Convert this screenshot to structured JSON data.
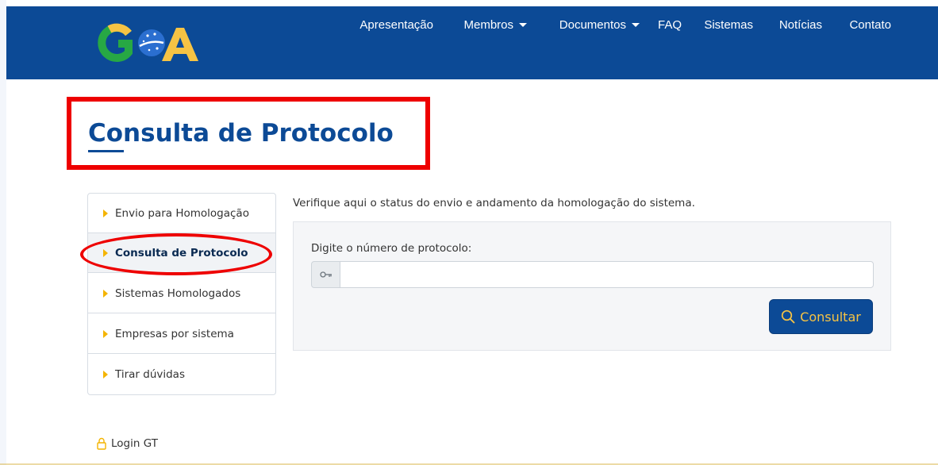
{
  "brand": {
    "logo_text": "GOA",
    "colors": {
      "navy": "#0c4a96",
      "yellow": "#f6c344",
      "green": "#27a844"
    }
  },
  "nav": {
    "items": [
      {
        "label": "Apresentação",
        "dropdown": false
      },
      {
        "label": "Membros",
        "dropdown": true
      },
      {
        "label": "Documentos",
        "dropdown": true
      },
      {
        "label": "FAQ",
        "dropdown": false
      },
      {
        "label": "Sistemas",
        "dropdown": false
      },
      {
        "label": "Notícias",
        "dropdown": false
      },
      {
        "label": "Contato",
        "dropdown": false
      }
    ]
  },
  "page": {
    "title": "Consulta de Protocolo"
  },
  "sidebar": {
    "active_index": 1,
    "items": [
      {
        "label": "Envio para Homologação"
      },
      {
        "label": "Consulta de Protocolo"
      },
      {
        "label": "Sistemas Homologados"
      },
      {
        "label": "Empresas por sistema"
      },
      {
        "label": "Tirar dúvidas"
      }
    ]
  },
  "main": {
    "intro": "Verifique aqui o status do envio e andamento da homologação do sistema.",
    "form": {
      "label": "Digite o número de protocolo:",
      "value": "",
      "placeholder": "",
      "addon_icon": "key-icon",
      "submit_label": "Consultar",
      "submit_icon": "search-icon"
    }
  },
  "footer": {
    "login_label": "Login GT",
    "login_icon": "lock-icon"
  },
  "annotations": {
    "highlight_color": "#ee0000"
  }
}
